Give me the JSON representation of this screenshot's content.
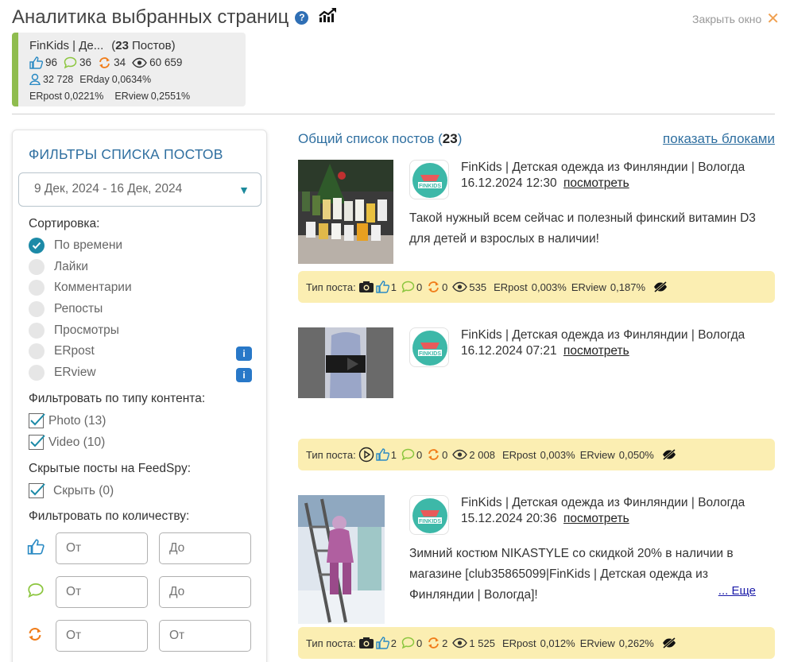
{
  "header": {
    "title": "Аналитика выбранных страниц",
    "help": "?",
    "close_label": "Закрыть окно"
  },
  "stats": {
    "page_name": "FinKids | Де...",
    "posts_count": "23",
    "posts_word": "Постов",
    "likes": "96",
    "comments": "36",
    "reposts": "34",
    "views": "60 659",
    "subscribers": "32 728",
    "erday_label": "ERday",
    "erday_value": "0,0634%",
    "erpost_label": "ERpost",
    "erpost_value": "0,0221%",
    "erview_label": "ERview",
    "erview_value": "0,2551%"
  },
  "filters": {
    "title": "ФИЛЬТРЫ СПИСКА ПОСТОВ",
    "date_range": "9 Дек, 2024 - 16 Дек, 2024",
    "sort_label": "Сортировка:",
    "sort_options": [
      "По времени",
      "Лайки",
      "Комментарии",
      "Репосты",
      "Просмотры",
      "ERpost",
      "ERview"
    ],
    "sort_selected": "По времени",
    "info_badge": "i",
    "content_label": "Фильтровать по типу контента:",
    "content_options": [
      "Photo (13)",
      "Video (10)"
    ],
    "hidden_label": "Скрытые посты на FeedSpy:",
    "hidden_option": "Скрыть (0)",
    "quantity_label": "Фильтровать по количеству:",
    "from_placeholder": "От",
    "to_placeholder": "До"
  },
  "list": {
    "title_prefix": "Общий список постов (",
    "count": "23",
    "title_suffix": ")",
    "blocks_link": "показать блоками"
  },
  "post_common": {
    "type_label": "Тип поста:",
    "view_link": "посмотреть",
    "more_link": "... Еще",
    "erpost_label": "ERpost",
    "erview_label": "ERview"
  },
  "posts": [
    {
      "author": "FinKids | Детская одежда из Финляндии | Вологда",
      "date": "16.12.2024 12:30",
      "text": "Такой нужный всем сейчас и полезный финский витамин D3 для детей и взрослых в наличии!",
      "type_icon": "camera-icon",
      "likes": "1",
      "comments": "0",
      "reposts": "0",
      "views": "535",
      "erpost": "0,003%",
      "erview": "0,187%"
    },
    {
      "author": "FinKids | Детская одежда из Финляндии | Вологда",
      "date": "16.12.2024 07:21",
      "text": "",
      "type_icon": "play-icon",
      "likes": "1",
      "comments": "0",
      "reposts": "0",
      "views": "2 008",
      "erpost": "0,003%",
      "erview": "0,050%"
    },
    {
      "author": "FinKids | Детская одежда из Финляндии | Вологда",
      "date": "15.12.2024 20:36",
      "text": "Зимний костюм NIKASTYLE со скидкой 20% в наличии в магазине [club35865099|FinKids | Детская одежда из Финляндии | Вологда]!",
      "type_icon": "camera-icon",
      "likes": "2",
      "comments": "0",
      "reposts": "2",
      "views": "1 525",
      "erpost": "0,012%",
      "erview": "0,262%"
    }
  ],
  "colors": {
    "accent_blue": "#2f6fa0",
    "like_blue": "#2a8ac4",
    "comment_green": "#8cc63f",
    "repost_orange": "#f07d1a",
    "card_green": "#8fbc4f",
    "bar_yellow": "#fbeeb2"
  }
}
